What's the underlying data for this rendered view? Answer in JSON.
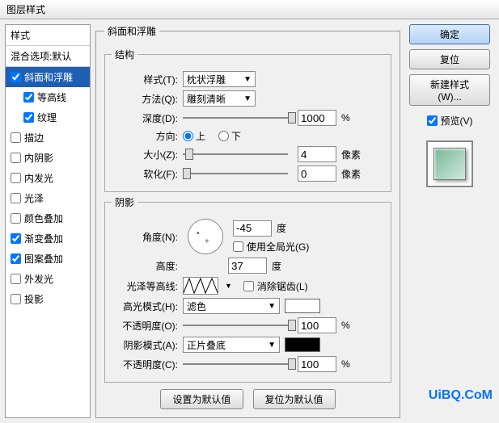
{
  "window": {
    "title": "图层样式"
  },
  "styles": {
    "header": "样式",
    "blend": "混合选项:默认",
    "items": [
      {
        "label": "斜面和浮雕",
        "checked": true,
        "selected": true
      },
      {
        "label": "等高线",
        "checked": true,
        "sub": true
      },
      {
        "label": "纹理",
        "checked": true,
        "sub": true
      },
      {
        "label": "描边",
        "checked": false
      },
      {
        "label": "内阴影",
        "checked": false
      },
      {
        "label": "内发光",
        "checked": false
      },
      {
        "label": "光泽",
        "checked": false
      },
      {
        "label": "颜色叠加",
        "checked": false
      },
      {
        "label": "渐变叠加",
        "checked": true
      },
      {
        "label": "图案叠加",
        "checked": true
      },
      {
        "label": "外发光",
        "checked": false
      },
      {
        "label": "投影",
        "checked": false
      }
    ]
  },
  "bevel": {
    "group": "斜面和浮雕",
    "structure": "结构",
    "style_label": "样式(T):",
    "style_value": "枕状浮雕",
    "technique_label": "方法(Q):",
    "technique_value": "雕刻清晰",
    "depth_label": "深度(D):",
    "depth_value": "1000",
    "percent": "%",
    "direction_label": "方向:",
    "dir_up": "上",
    "dir_down": "下",
    "size_label": "大小(Z):",
    "size_value": "4",
    "px": "像素",
    "soften_label": "软化(F):",
    "soften_value": "0"
  },
  "shading": {
    "group": "阴影",
    "angle_label": "角度(N):",
    "angle_value": "-45",
    "deg": "度",
    "global_label": "使用全局光(G)",
    "altitude_label": "高度:",
    "altitude_value": "37",
    "gloss_label": "光泽等高线:",
    "antialias_label": "消除锯齿(L)",
    "highlight_label": "高光模式(H):",
    "highlight_value": "滤色",
    "highlight_opacity_label": "不透明度(O):",
    "highlight_opacity_value": "100",
    "shadow_label": "阴影模式(A):",
    "shadow_value": "正片叠底",
    "shadow_opacity_label": "不透明度(C):",
    "shadow_opacity_value": "100"
  },
  "buttons": {
    "default": "设置为默认值",
    "reset_default": "复位为默认值",
    "ok": "确定",
    "reset": "复位",
    "newstyle": "新建样式(W)...",
    "preview": "预览(V)"
  },
  "watermark": "UiBQ.CoM"
}
